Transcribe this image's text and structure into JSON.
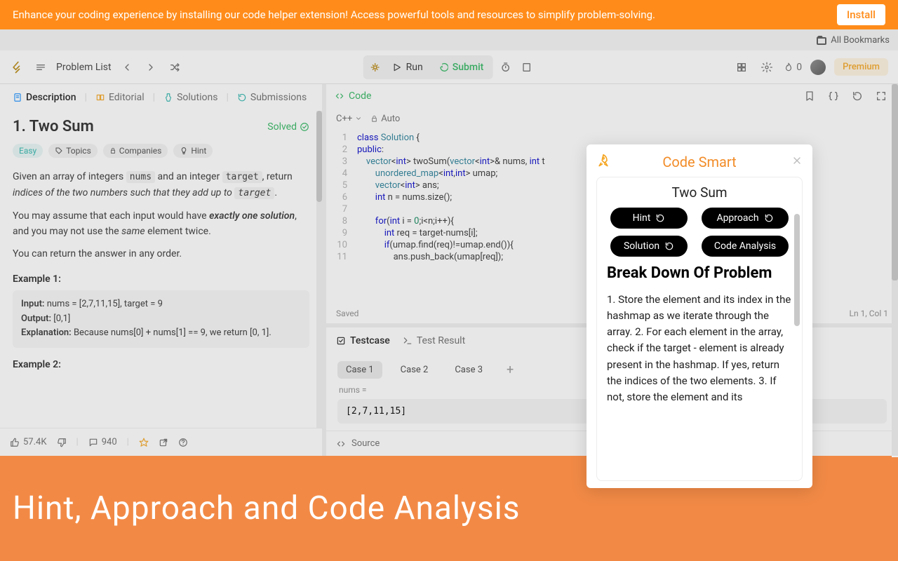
{
  "install_bar": {
    "text": "Enhance your coding experience by installing our code helper extension! Access powerful tools and resources to simplify problem-solving.",
    "button": "Install"
  },
  "bookmarks": {
    "label": "All Bookmarks"
  },
  "toolbar": {
    "problem_list": "Problem List",
    "run": "Run",
    "submit": "Submit",
    "streak": "0",
    "premium": "Premium"
  },
  "tabs": {
    "description": "Description",
    "editorial": "Editorial",
    "solutions": "Solutions",
    "submissions": "Submissions"
  },
  "problem": {
    "title": "1. Two Sum",
    "solved": "Solved",
    "difficulty": "Easy",
    "chips": {
      "topics": "Topics",
      "companies": "Companies",
      "hint": "Hint"
    },
    "para1_pre": "Given an array of integers ",
    "para1_code1": "nums",
    "para1_mid": " and an integer ",
    "para1_code2": "target",
    "para1_post": ", return ",
    "para1_em": "indices of the two numbers such that they add up to ",
    "para1_code3": "target",
    "para1_end": ".",
    "para2": "You may assume that each input would have exactly one solution, and you may not use the same element twice.",
    "para2_pre": "You may assume that each input would have ",
    "para2_strong": "exactly one solution",
    "para2_mid": ", and you may not use the ",
    "para2_em": "same",
    "para2_post": " element twice.",
    "para3": "You can return the answer in any order.",
    "ex1_label": "Example 1:",
    "ex1": {
      "input_k": "Input:",
      "input_v": " nums = [2,7,11,15], target = 9",
      "output_k": "Output:",
      "output_v": " [0,1]",
      "expl_k": "Explanation:",
      "expl_v": " Because nums[0] + nums[1] == 9, we return [0, 1]."
    },
    "ex2_label": "Example 2:"
  },
  "desc_footer": {
    "likes": "57.4K",
    "comments": "940"
  },
  "code_panel": {
    "label": "Code",
    "lang": "C++",
    "auto": "Auto",
    "saved": "Saved",
    "pos": "Ln 1, Col 1"
  },
  "code": {
    "l1": "class Solution {",
    "l2": "public:",
    "l3": "    vector<int> twoSum(vector<int>& nums, int t",
    "l4": "        unordered_map<int,int> umap;",
    "l5": "        vector<int> ans;",
    "l6": "        int n = nums.size();",
    "l7": "",
    "l8": "        for(int i = 0;i<n;i++){",
    "l9": "            int req = target-nums[i];",
    "l10": "            if(umap.find(req)!=umap.end()){",
    "l11": "                ans.push_back(umap[req]);"
  },
  "testcase": {
    "tab1": "Testcase",
    "tab2": "Test Result",
    "case1": "Case 1",
    "case2": "Case 2",
    "case3": "Case 3",
    "label": "nums =",
    "value": "[2,7,11,15]",
    "source": "Source"
  },
  "smart": {
    "title": "Code Smart",
    "problem": "Two Sum",
    "btn_hint": "Hint",
    "btn_approach": "Approach",
    "btn_solution": "Solution",
    "btn_analysis": "Code Analysis",
    "section": "Break Down Of Problem",
    "content": "1. Store the element and its index in the hashmap as we iterate through the array. 2. For each element in the array, check if the target - element is already present in the hashmap. If yes, return the indices of the two elements. 3. If not, store the element and its"
  },
  "bottom": "Hint, Approach and Code Analysis"
}
